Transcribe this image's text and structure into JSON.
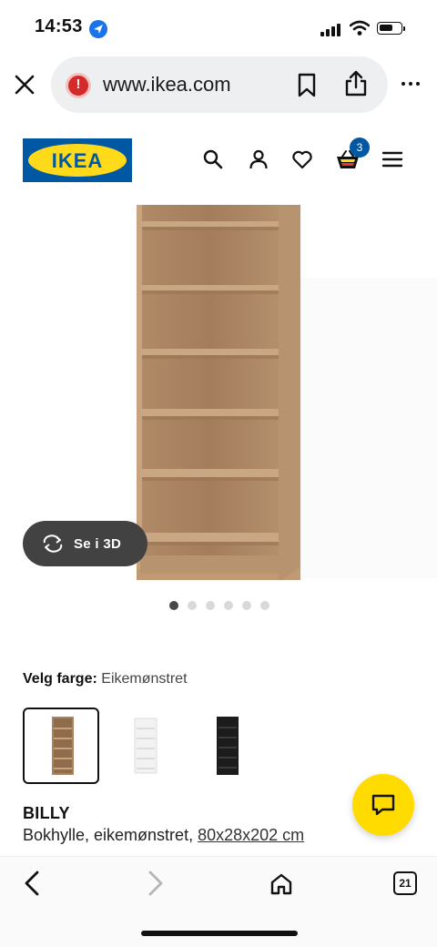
{
  "status_bar": {
    "time": "14:53"
  },
  "browser": {
    "url": "www.ikea.com",
    "tabs_count": "21"
  },
  "header": {
    "logo_text": "IKEA",
    "cart_count": "3"
  },
  "gallery": {
    "view_3d_label": "Se i 3D",
    "total_images": 6,
    "active_index": 0
  },
  "product": {
    "color_label": "Velg farge:",
    "color_value": "Eikemønstret",
    "color_options": [
      {
        "name": "Eikemønstret",
        "selected": true
      },
      {
        "name": "Hvit",
        "selected": false
      },
      {
        "name": "Svart",
        "selected": false
      }
    ],
    "name": "BILLY",
    "description_prefix": "Bokhylle, eikemønstret, ",
    "dimensions": "80x28x202 cm"
  },
  "colors": {
    "brand_blue": "#0058a3",
    "brand_yellow": "#ffda1a",
    "chat_yellow": "#ffdb00"
  }
}
